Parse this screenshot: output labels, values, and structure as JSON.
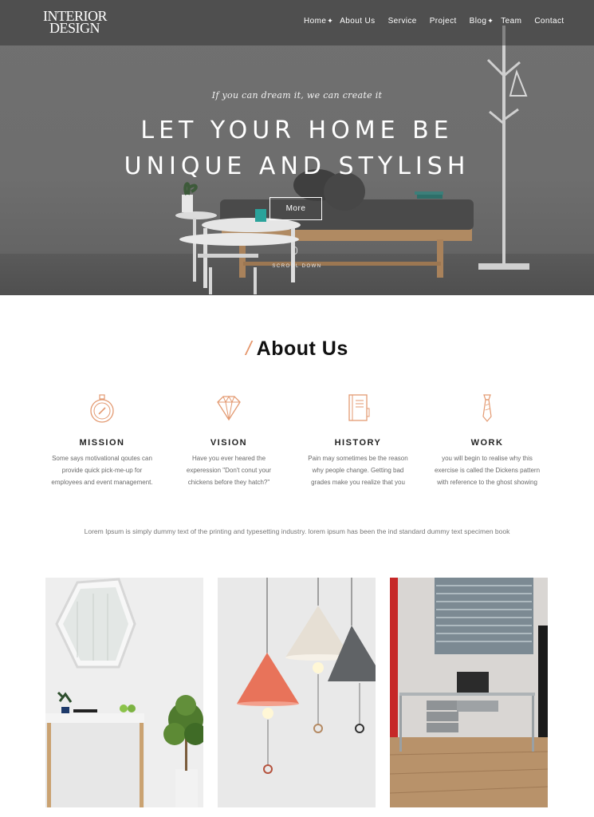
{
  "logo": {
    "line1": "INTERIOR",
    "line2": "DESIGN"
  },
  "nav": [
    {
      "label": "Home",
      "dropdown": true
    },
    {
      "label": "About Us",
      "dropdown": false
    },
    {
      "label": "Service",
      "dropdown": false
    },
    {
      "label": "Project",
      "dropdown": false
    },
    {
      "label": "Blog",
      "dropdown": true
    },
    {
      "label": "Team",
      "dropdown": false
    },
    {
      "label": "Contact",
      "dropdown": false
    }
  ],
  "hero": {
    "tagline": "If you can dream it, we can create it",
    "headline_line1": "LET YOUR HOME BE",
    "headline_line2": "UNIQUE AND STYLISH",
    "button": "More",
    "scroll": "SCROOL DOWN"
  },
  "about": {
    "title": "About Us",
    "slash": "/",
    "features": [
      {
        "icon": "compass-icon",
        "title": "MISSION",
        "lines": [
          "Some says motivational qoutes can",
          "provide quick pick-me-up for",
          "employees and event management."
        ]
      },
      {
        "icon": "diamond-icon",
        "title": "VISION",
        "lines": [
          "Have you ever heared the",
          "experession \"Don't conut your",
          "chickens before they hatch?\""
        ]
      },
      {
        "icon": "book-icon",
        "title": "HISTORY",
        "lines": [
          "Pain may sometimes be the reason",
          "why people change. Getting bad",
          "grades make you realize that you"
        ]
      },
      {
        "icon": "tie-icon",
        "title": "WORK",
        "lines": [
          "you will begin to realise why this",
          "exercise is called the Dickens pattern",
          "with reference to the ghost showing"
        ]
      }
    ],
    "summary": "Lorem Ipsum is simply dummy text of the printing and typesetting industry. lorem ipsum has been the ind standard dummy text specimen book"
  },
  "colors": {
    "accent": "#e5956a",
    "hero_overlay": "#6e6e6e",
    "icon_stroke": "#e39a72"
  }
}
